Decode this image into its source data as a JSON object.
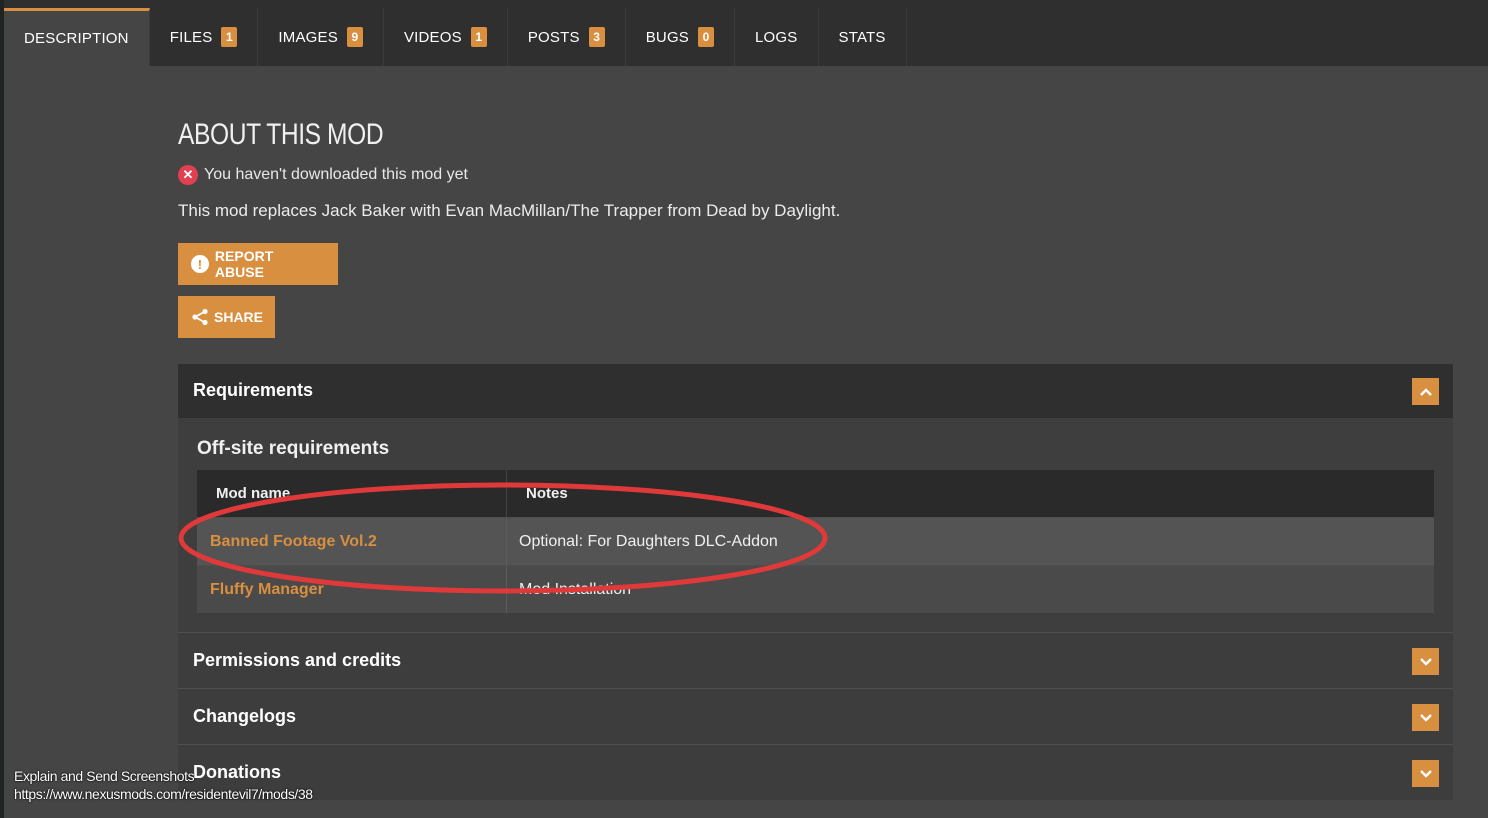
{
  "tabs": [
    {
      "label": "DESCRIPTION",
      "count": null,
      "active": true
    },
    {
      "label": "FILES",
      "count": "1"
    },
    {
      "label": "IMAGES",
      "count": "9"
    },
    {
      "label": "VIDEOS",
      "count": "1"
    },
    {
      "label": "POSTS",
      "count": "3"
    },
    {
      "label": "BUGS",
      "count": "0"
    },
    {
      "label": "LOGS",
      "count": null
    },
    {
      "label": "STATS",
      "count": null
    }
  ],
  "about": {
    "title": "ABOUT THIS MOD",
    "download_status": "You haven't downloaded this mod yet",
    "description": "This mod replaces Jack Baker with Evan MacMillan/The Trapper from Dead by Daylight.",
    "report_label": "REPORT ABUSE",
    "share_label": "SHARE"
  },
  "requirements": {
    "title": "Requirements",
    "offsite_title": "Off-site requirements",
    "columns": [
      "Mod name",
      "Notes"
    ],
    "rows": [
      {
        "name": "Banned Footage Vol.2",
        "notes": "Optional: For Daughters DLC-Addon"
      },
      {
        "name": "Fluffy Manager",
        "notes": "Mod Installation"
      }
    ]
  },
  "sections": {
    "permissions": "Permissions and credits",
    "changelogs": "Changelogs",
    "donations": "Donations"
  },
  "overlay": {
    "line1": "Explain and Send Screenshots",
    "line2": "https://www.nexusmods.com/residentevil7/mods/38"
  },
  "colors": {
    "accent": "#d98f40",
    "error": "#e04050",
    "annotation": "#e0393a"
  },
  "icons": {
    "download_status": "x-circle-icon",
    "report": "exclamation-icon",
    "share": "share-icon",
    "expanded": "chevron-up-icon",
    "collapsed": "chevron-down-icon"
  }
}
